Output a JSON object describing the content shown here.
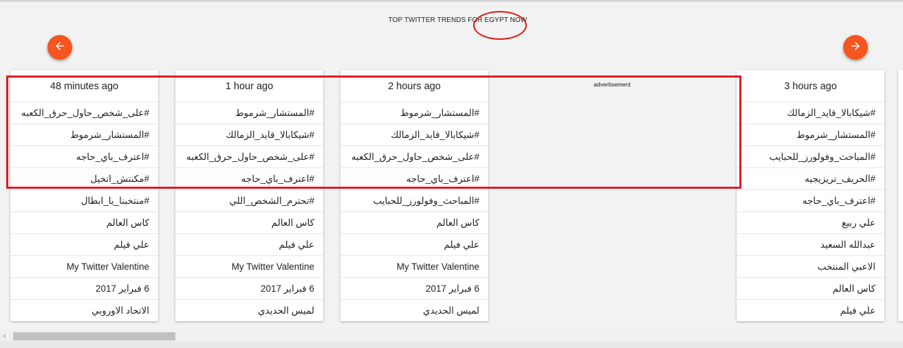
{
  "page": {
    "title": "TOP TWITTER TRENDS FOR EGYPT NOW",
    "advertisement_label": "advertisement"
  },
  "icons": {
    "prev": "arrow-left-icon",
    "next": "arrow-right-icon"
  },
  "colors": {
    "accent": "#f5561f",
    "annotation_red": "#e01a22"
  },
  "columns": [
    {
      "time": "48 minutes ago",
      "trends": [
        "#على_شخص_حاول_حرق_الكعبه",
        "#المستشار_شرموط",
        "#اعترف_باي_حاجه",
        "#مكنتش_اتخيل",
        "#منتخبنا_يا_ابطال",
        "كاس العالم",
        "علي فيلم",
        "My Twitter Valentine",
        "6 فبراير 2017",
        "الاتحاد الاوروبي"
      ]
    },
    {
      "time": "1 hour ago",
      "trends": [
        "#المستشار_شرموط",
        "#شيكابالا_قايد_الزمالك",
        "#على_شخص_حاول_حرق_الكعبه",
        "#اعترف_باي_حاجه",
        "#تحترم_الشخص_اللي",
        "كاس العالم",
        "علي فيلم",
        "My Twitter Valentine",
        "6 فبراير 2017",
        "لميس الحديدي"
      ]
    },
    {
      "time": "2 hours ago",
      "trends": [
        "#المستشار_شرموط",
        "#شيكابالا_قايد_الزمالك",
        "#على_شخص_حاول_حرق_الكعبه",
        "#اعترف_باي_حاجه",
        "#المباحث_وفولورز_للحبايب",
        "كاس العالم",
        "علي فيلم",
        "My Twitter Valentine",
        "6 فبراير 2017",
        "لميس الحديدي"
      ]
    },
    {
      "time": "3 hours ago",
      "trends": [
        "#شيكابالا_قايد_الزمالك",
        "#المستشار_شرموط",
        "#المباحث_وفولورز_للحبايب",
        "#الحريف_تريزيجيه",
        "#اعترف_باي_حاجه",
        "علي ربيع",
        "عبدالله السعيد",
        "الاعبي المنتخب",
        "كاس العالم",
        "علي فيلم"
      ]
    }
  ],
  "scrollbar": {
    "left_arrow": "‹"
  }
}
